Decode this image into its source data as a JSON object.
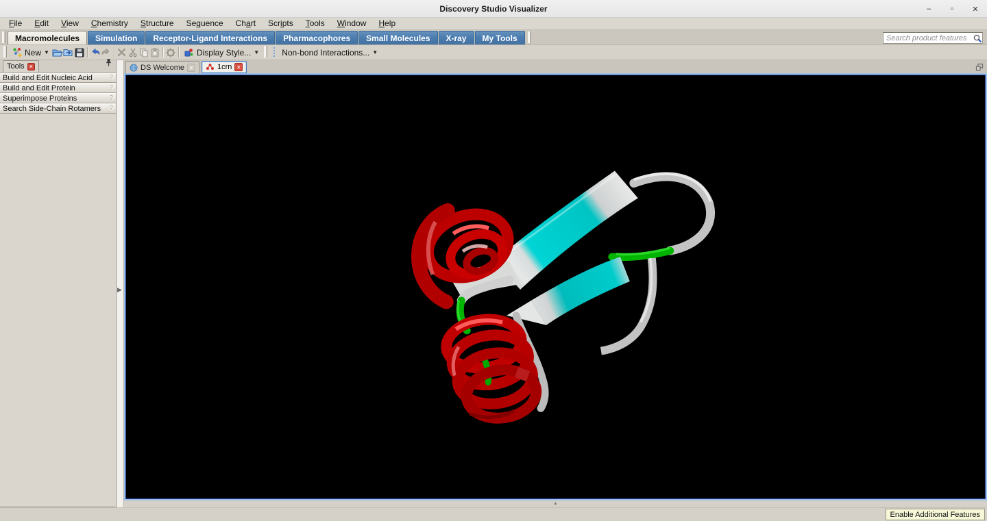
{
  "window": {
    "title": "Discovery Studio Visualizer",
    "controls": {
      "minimize": "–",
      "maximize": "▫",
      "close": "✕"
    }
  },
  "menu": {
    "items": [
      {
        "label": "File",
        "mnemonic": 0
      },
      {
        "label": "Edit",
        "mnemonic": 0
      },
      {
        "label": "View",
        "mnemonic": 0
      },
      {
        "label": "Chemistry",
        "mnemonic": 0
      },
      {
        "label": "Structure",
        "mnemonic": 0
      },
      {
        "label": "Sequence",
        "mnemonic": 2
      },
      {
        "label": "Chart",
        "mnemonic": 2
      },
      {
        "label": "Scripts",
        "mnemonic": 3
      },
      {
        "label": "Tools",
        "mnemonic": 0
      },
      {
        "label": "Window",
        "mnemonic": 0
      },
      {
        "label": "Help",
        "mnemonic": 0
      }
    ]
  },
  "ribbon": {
    "tabs": [
      {
        "label": "Macromolecules",
        "active": true
      },
      {
        "label": "Simulation",
        "active": false
      },
      {
        "label": "Receptor-Ligand Interactions",
        "active": false
      },
      {
        "label": "Pharmacophores",
        "active": false
      },
      {
        "label": "Small Molecules",
        "active": false
      },
      {
        "label": "X-ray",
        "active": false
      },
      {
        "label": "My Tools",
        "active": false
      }
    ],
    "search": {
      "placeholder": "Search product features",
      "value": ""
    }
  },
  "toolbar": {
    "new_label": "New",
    "display_style_label": "Display Style...",
    "nonbond_label": "Non-bond Interactions...",
    "icons": [
      "new-document-icon",
      "open-file-icon",
      "insert-file-icon",
      "save-icon",
      "undo-icon",
      "redo-icon",
      "delete-icon",
      "cut-icon",
      "copy-icon",
      "paste-icon",
      "settings-gear-icon",
      "display-style-icon"
    ]
  },
  "tools_panel": {
    "title": "Tools",
    "items": [
      {
        "label": "Build and Edit Nucleic Acid"
      },
      {
        "label": "Build and Edit Protein"
      },
      {
        "label": "Superimpose Proteins"
      },
      {
        "label": "Search Side-Chain Rotamers"
      }
    ],
    "expander_glyph": "?"
  },
  "document_tabs": [
    {
      "label": "DS Welcome",
      "icon": "globe",
      "active": false,
      "close_style": "disabled"
    },
    {
      "label": "1crn",
      "icon": "molecule",
      "active": true,
      "close_style": "red"
    }
  ],
  "viewport": {
    "content": "protein ribbon structure 1crn",
    "colors": {
      "helix": "#c00000",
      "sheet": "#00cccc",
      "turn": "#00b400",
      "coil": "#c6c6c6",
      "background": "#000000"
    }
  },
  "collapse_strip": {
    "glyph": "▲"
  },
  "splitter": {
    "glyph": "▶"
  },
  "status_bar": {
    "enable_features_label": "Enable Additional Features"
  }
}
